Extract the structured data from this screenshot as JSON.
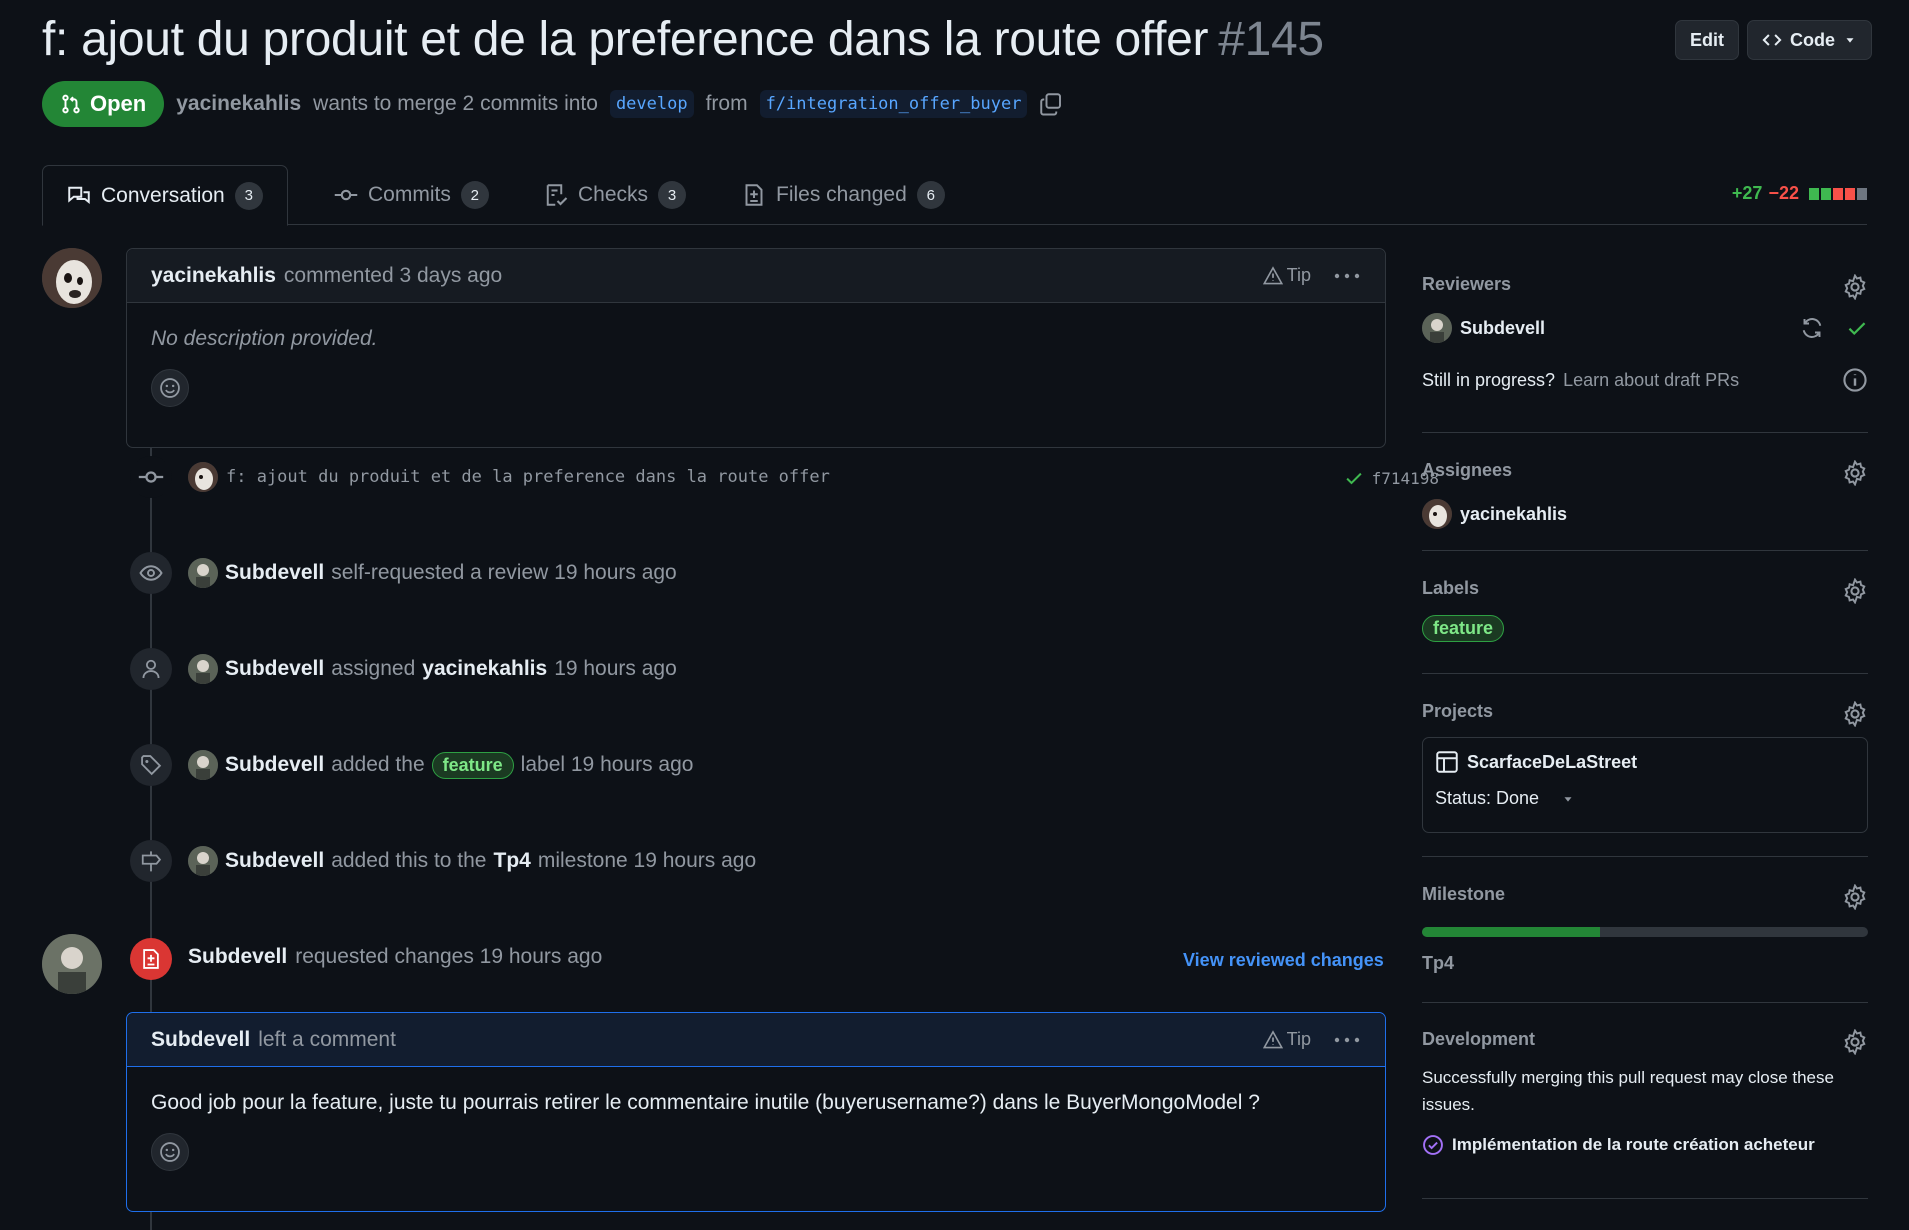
{
  "pr": {
    "title": "f: ajout du produit et de la preference dans la route offer",
    "number": "#145",
    "state": "Open",
    "author": "yacinekahlis",
    "merge_text": "wants to merge 2 commits into",
    "base_branch": "develop",
    "from_text": "from",
    "head_branch": "f/integration_offer_buyer"
  },
  "header_actions": {
    "edit": "Edit",
    "code": "Code"
  },
  "tabs": [
    {
      "label": "Conversation",
      "count": "3"
    },
    {
      "label": "Commits",
      "count": "2"
    },
    {
      "label": "Checks",
      "count": "3"
    },
    {
      "label": "Files changed",
      "count": "6"
    }
  ],
  "diffstat": {
    "additions": "+27",
    "deletions": "−22"
  },
  "first_comment": {
    "author": "yacinekahlis",
    "meta": "commented 3 days ago",
    "tip": "Tip",
    "body": "No description provided."
  },
  "commit_event": {
    "message": "f: ajout du produit et de la preference dans la route offer",
    "sha": "f714198"
  },
  "events": [
    {
      "actor": "Subdevell",
      "text": "self-requested a review 19 hours ago"
    },
    {
      "actor": "Subdevell",
      "text": "assigned",
      "target": "yacinekahlis",
      "time": "19 hours ago"
    },
    {
      "actor": "Subdevell",
      "text": "added the",
      "label": "feature",
      "tail": "label 19 hours ago"
    },
    {
      "actor": "Subdevell",
      "text": "added this to the",
      "target": "Tp4",
      "tail": "milestone 19 hours ago"
    }
  ],
  "review": {
    "actor": "Subdevell",
    "text": "requested changes 19 hours ago",
    "link": "View reviewed changes",
    "comment_author": "Subdevell",
    "comment_meta": "left a comment",
    "tip": "Tip",
    "body": "Good job pour la feature, juste tu pourrais retirer le commentaire inutile (buyerusername?) dans le BuyerMongoModel ?"
  },
  "sidebar": {
    "reviewers": {
      "title": "Reviewers",
      "name": "Subdevell",
      "draft_q": "Still in progress?",
      "draft_link": "Learn about draft PRs"
    },
    "assignees": {
      "title": "Assignees",
      "name": "yacinekahlis"
    },
    "labels": {
      "title": "Labels",
      "label": "feature"
    },
    "projects": {
      "title": "Projects",
      "name": "ScarfaceDeLaStreet",
      "status": "Status: Done"
    },
    "milestone": {
      "title": "Milestone",
      "name": "Tp4",
      "progress": 0.4
    },
    "development": {
      "title": "Development",
      "text": "Successfully merging this pull request may close these issues.",
      "issue": "Implémentation de la route création acheteur"
    }
  },
  "colors": {
    "open": "#238636",
    "accent": "#4493f8",
    "danger": "#da3633",
    "done": "#a371f7"
  }
}
